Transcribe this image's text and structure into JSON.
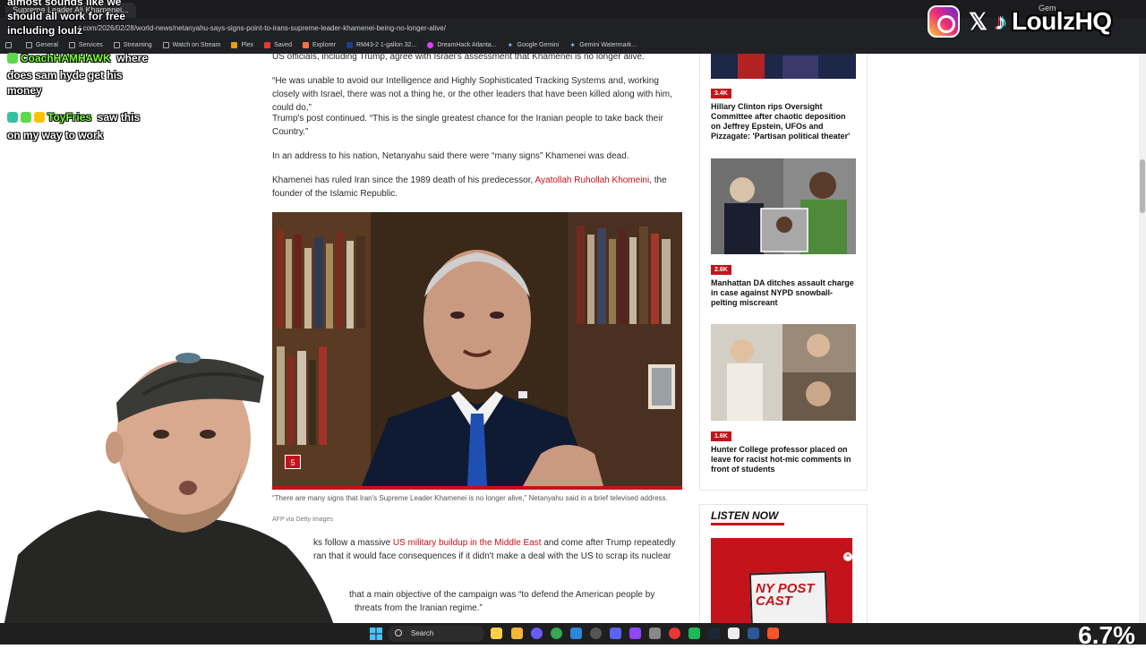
{
  "browser": {
    "tab_title": "Supreme Leader Ali Khamenei...",
    "tab_right": "Gem",
    "url": "t.com/2026/02/28/world-news/netanyahu-says-signs-point-to-irans-supreme-leader-khamenei-being-no-longer-alive/",
    "bookmarks": [
      "General",
      "Services",
      "Streaming",
      "Watch on Stream",
      "Plex",
      "Saved",
      "Explorer",
      "RM43-2 1-gallon 32...",
      "DreamHack Atlanta...",
      "Google Gemini",
      "Gemini Watermark..."
    ]
  },
  "chat": {
    "line1": "almost sounds like we",
    "line2": "should all work for free",
    "line3": "including loulz",
    "msg2_user": "CoachHAMHAWK",
    "msg2_text1": "where",
    "msg2_text2": "does sam hyde get his",
    "msg2_text3": "money",
    "msg3_user": "ToyFries",
    "msg3_text1": "saw this",
    "msg3_text2": "on my way to work"
  },
  "socials": {
    "x_glyph": "𝕏",
    "tiktok_glyph": "♪",
    "handle": "LoulzHQ"
  },
  "article": {
    "p0": "US officials, including Trump, agree with Israel's assessment that Khamenei is no longer alive.",
    "p1": "“He was unable to avoid our Intelligence and Highly Sophisticated Tracking Systems and, working closely with Israel, there was not a thing he, or the other leaders that have been killed along with him, could do,”",
    "p2": "Trump's post continued. “This is the single greatest chance for the Iranian people to take back their Country.”",
    "p3": "In an address to his nation, Netanyahu said there were “many signs” Khamenei was dead.",
    "p4_a": "Khamenei has ruled Iran since the 1989 death of his predecessor, ",
    "p4_link": "Ayatollah Ruhollah Khomeini",
    "p4_b": ", the founder of the Islamic Republic.",
    "gallery_count": "5",
    "caption": "“There are many signs that Iran's Supreme Leader Khamenei is no longer alive,” Netanyahu said in a brief televised address.",
    "credit": "AFP via Getty Images",
    "p5_a": "ks follow a massive ",
    "p5_link": "US military buildup in the Middle East",
    "p5_b": " and come after Trump repeatedly",
    "p5_c": "ran that it would face consequences if it didn't make a deal with the US to scrap its nuclear",
    "p6_a": "that a main objective of the campaign was “to defend the American people by",
    "p6_b": "threats from the Iranian regime.”"
  },
  "sidebar": {
    "items": [
      {
        "count": "3.4K",
        "headline": "Hillary Clinton rips Oversight Committee after chaotic deposition on Jeffrey Epstein, UFOs and Pizzagate: 'Partisan political theater'"
      },
      {
        "count": "2.6K",
        "headline": "Manhattan DA ditches assault charge in case against NYPD snowball-pelting miscreant"
      },
      {
        "count": "1.6K",
        "headline": "Hunter College professor placed on leave for racist hot-mic comments in front of students"
      }
    ],
    "listen_now": "LISTEN NOW",
    "podcast_text": "NY POST CAST"
  },
  "taskbar": {
    "search": "Search",
    "tray_big": "6.7%"
  },
  "colors": {
    "accent": "#c4131b",
    "chat_name_green": "#7cff3a",
    "chat_name_orange": "#ffcc33"
  }
}
